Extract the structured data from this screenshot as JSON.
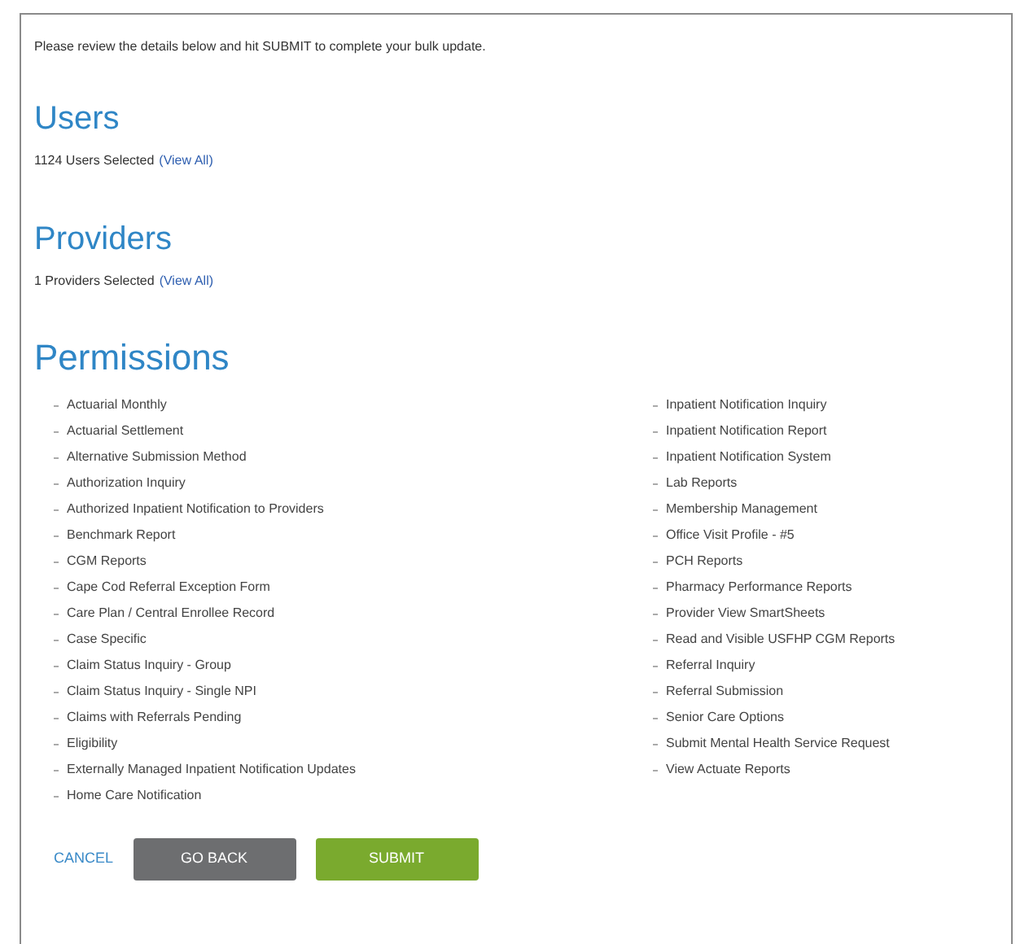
{
  "intro": "Please review the details below and hit SUBMIT to complete your bulk update.",
  "sections": [
    {
      "title": "Users",
      "summary": "1124 Users Selected",
      "link": "(View All)"
    },
    {
      "title": "Providers",
      "summary": "1 Providers Selected",
      "link": "(View All)"
    }
  ],
  "permissions": {
    "title": "Permissions",
    "columns": [
      [
        "Actuarial Monthly",
        "Actuarial Settlement",
        "Alternative Submission Method",
        "Authorization Inquiry",
        "Authorized Inpatient Notification to Providers",
        "Benchmark Report",
        "CGM Reports",
        "Cape Cod Referral Exception Form",
        "Care Plan / Central Enrollee Record",
        "Case Specific",
        "Claim Status Inquiry - Group",
        "Claim Status Inquiry - Single NPI",
        "Claims with Referrals Pending",
        "Eligibility",
        "Externally Managed Inpatient Notification Updates",
        "Home Care Notification"
      ],
      [
        "Inpatient Notification Inquiry",
        "Inpatient Notification Report",
        "Inpatient Notification System",
        "Lab Reports",
        "Membership Management",
        "Office Visit Profile - #5",
        "PCH Reports",
        "Pharmacy Performance Reports",
        "Provider View SmartSheets",
        "Read and Visible USFHP CGM Reports",
        "Referral Inquiry",
        "Referral Submission",
        "Senior Care Options",
        "Submit Mental Health Service Request",
        "View Actuate Reports"
      ]
    ]
  },
  "actions": [
    {
      "kind": "link",
      "label": "CANCEL"
    },
    {
      "kind": "secondary",
      "label": "GO BACK"
    },
    {
      "kind": "primary",
      "label": "SUBMIT"
    }
  ]
}
